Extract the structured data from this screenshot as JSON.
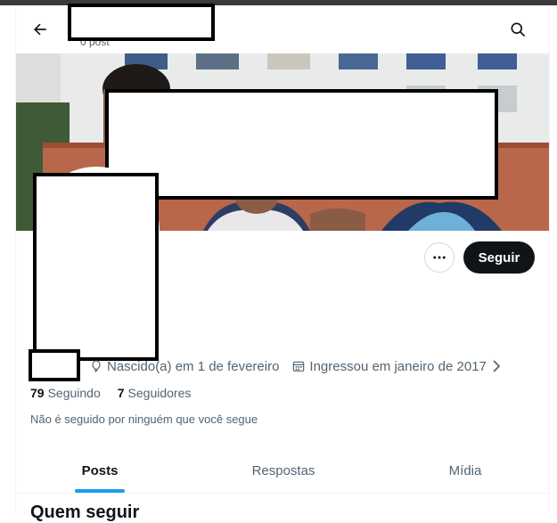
{
  "header": {
    "post_count": "0 post",
    "back_icon": "arrow-left-icon",
    "search_icon": "search-icon"
  },
  "profile": {
    "more_icon": "more-horizontal-icon",
    "follow_label": "Seguir",
    "birth_text": "Nascido(a) em 1 de fevereiro",
    "birth_icon": "balloon-icon",
    "joined_text": "Ingressou em janeiro de 2017",
    "joined_icon": "calendar-icon",
    "chevron_icon": "chevron-right-icon",
    "following_count": "79",
    "following_label": "Seguindo",
    "followers_count": "7",
    "followers_label": "Seguidores",
    "not_followed_text": "Não é seguido por ninguém que você segue"
  },
  "tabs": [
    {
      "label": "Posts",
      "active": true
    },
    {
      "label": "Respostas",
      "active": false
    },
    {
      "label": "Mídia",
      "active": false
    }
  ],
  "who_to_follow": {
    "title": "Quem seguir"
  },
  "colors": {
    "accent": "#1d9bf0",
    "text_primary": "#0f1419",
    "text_secondary": "#536471",
    "follow_button_bg": "#0f1419"
  }
}
